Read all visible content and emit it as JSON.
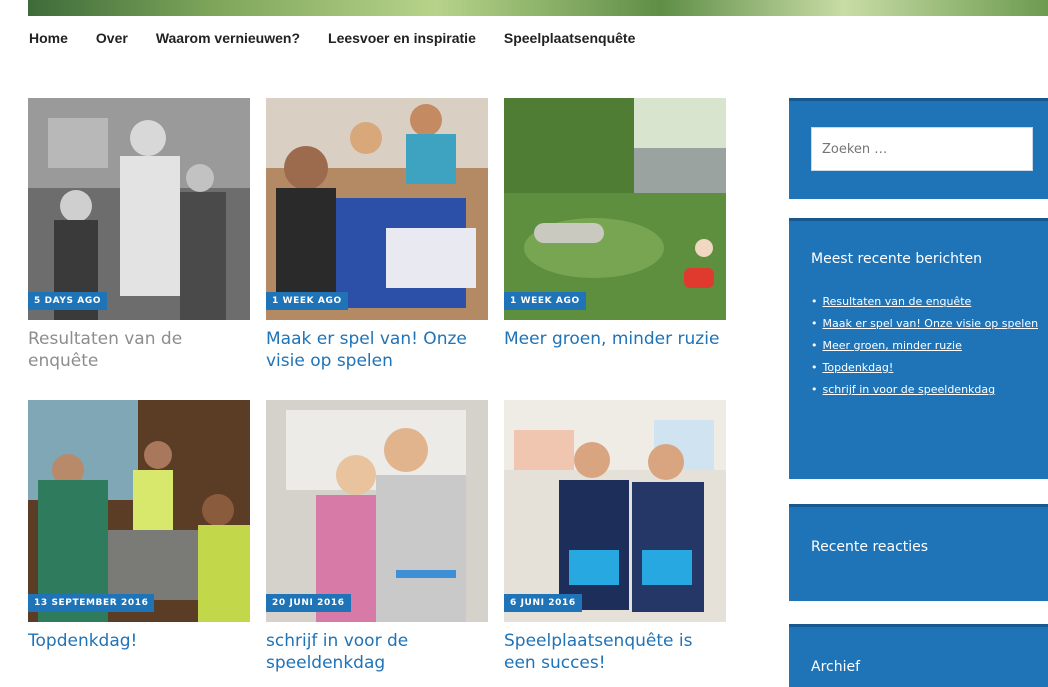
{
  "nav": {
    "items": [
      {
        "label": "Home"
      },
      {
        "label": "Over"
      },
      {
        "label": "Waarom vernieuwen?"
      },
      {
        "label": "Leesvoer en inspiratie"
      },
      {
        "label": "Speelplaatsenquête"
      }
    ]
  },
  "posts": [
    {
      "date": "5 DAYS AGO",
      "title": "Resultaten van de enquête"
    },
    {
      "date": "1 WEEK AGO",
      "title": "Maak er spel van! Onze visie op spelen"
    },
    {
      "date": "1 WEEK AGO",
      "title": "Meer groen, minder ruzie"
    },
    {
      "date": "13 SEPTEMBER 2016",
      "title": "Topdenkdag!"
    },
    {
      "date": "20 JUNI 2016",
      "title": "schrijf in voor de speeldenkdag"
    },
    {
      "date": "6 JUNI 2016",
      "title": "Speelplaatsenquête is een succes!"
    }
  ],
  "sidebar": {
    "search": {
      "placeholder": "Zoeken …"
    },
    "recent_posts": {
      "title": "Meest recente berichten",
      "items": [
        "Resultaten van de enquête",
        "Maak er spel van! Onze visie op spelen",
        "Meer groen, minder ruzie",
        "Topdenkdag!",
        "schrijf in voor de speeldenkdag"
      ]
    },
    "recent_comments": {
      "title": "Recente reacties"
    },
    "archive": {
      "title": "Archief"
    }
  },
  "colors": {
    "accent": "#1f73b7",
    "muted_title": "#8d8d8d"
  }
}
